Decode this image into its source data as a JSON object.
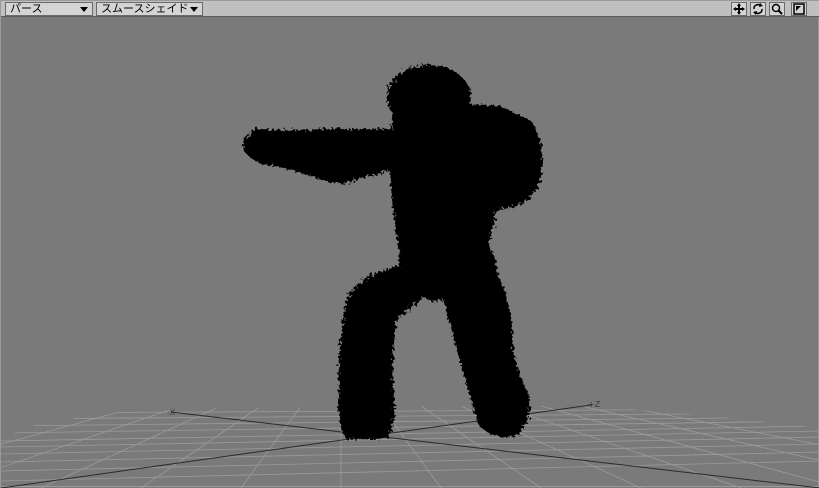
{
  "viewport": {
    "view_mode": "パース",
    "shading_mode": "スムースシェイド",
    "axis_label_x": "-X",
    "axis_label_z": "+Z"
  },
  "tools": [
    {
      "icon": "move-view-icon"
    },
    {
      "icon": "rotate-view-icon"
    },
    {
      "icon": "zoom-view-icon"
    },
    {
      "icon": "maximize-viewport-icon"
    }
  ],
  "colors": {
    "background": "#7a7a7a",
    "grid": "#9a9a9a",
    "silhouette": "#000000",
    "toolbar": "#c0c0c0"
  }
}
